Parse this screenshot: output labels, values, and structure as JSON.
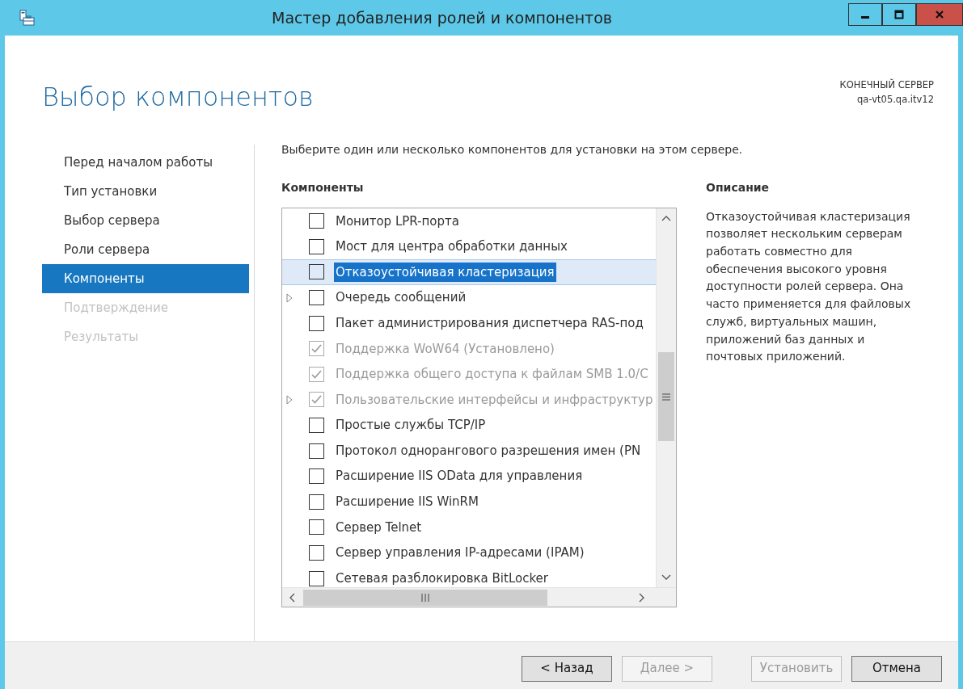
{
  "window": {
    "title": "Мастер добавления ролей и компонентов"
  },
  "page_title": "Выбор компонентов",
  "destination": {
    "label": "КОНЕЧНЫЙ СЕРВЕР",
    "server": "qa-vt05.qa.itv12"
  },
  "steps": [
    {
      "label": "Перед началом работы",
      "selected": false,
      "disabled": false
    },
    {
      "label": "Тип установки",
      "selected": false,
      "disabled": false
    },
    {
      "label": "Выбор сервера",
      "selected": false,
      "disabled": false
    },
    {
      "label": "Роли сервера",
      "selected": false,
      "disabled": false
    },
    {
      "label": "Компоненты",
      "selected": true,
      "disabled": false
    },
    {
      "label": "Подтверждение",
      "selected": false,
      "disabled": true
    },
    {
      "label": "Результаты",
      "selected": false,
      "disabled": true
    }
  ],
  "instruction": "Выберите один или несколько компонентов для установки на этом сервере.",
  "features": {
    "heading": "Компоненты",
    "items": [
      {
        "label": "Монитор LPR-порта",
        "expandable": false,
        "checked": false,
        "disabled": false,
        "selected": false
      },
      {
        "label": "Мост для центра обработки данных",
        "expandable": false,
        "checked": false,
        "disabled": false,
        "selected": false
      },
      {
        "label": "Отказоустойчивая кластеризация",
        "expandable": false,
        "checked": false,
        "disabled": false,
        "selected": true
      },
      {
        "label": "Очередь сообщений",
        "expandable": true,
        "checked": false,
        "disabled": false,
        "selected": false
      },
      {
        "label": "Пакет администрирования диспетчера RAS-под",
        "expandable": false,
        "checked": false,
        "disabled": false,
        "selected": false
      },
      {
        "label": "Поддержка WoW64 (Установлено)",
        "expandable": false,
        "checked": true,
        "disabled": true,
        "selected": false
      },
      {
        "label": "Поддержка общего доступа к файлам SMB 1.0/С",
        "expandable": false,
        "checked": true,
        "disabled": true,
        "selected": false
      },
      {
        "label": "Пользовательские интерфейсы и инфраструктур",
        "expandable": true,
        "checked": true,
        "disabled": true,
        "selected": false
      },
      {
        "label": "Простые службы TCP/IP",
        "expandable": false,
        "checked": false,
        "disabled": false,
        "selected": false
      },
      {
        "label": "Протокол однорангового разрешения имен (PN",
        "expandable": false,
        "checked": false,
        "disabled": false,
        "selected": false
      },
      {
        "label": "Расширение IIS OData для управления",
        "expandable": false,
        "checked": false,
        "disabled": false,
        "selected": false
      },
      {
        "label": "Расширение IIS WinRM",
        "expandable": false,
        "checked": false,
        "disabled": false,
        "selected": false
      },
      {
        "label": "Сервер Telnet",
        "expandable": false,
        "checked": false,
        "disabled": false,
        "selected": false
      },
      {
        "label": "Сервер управления IP-адресами (IPAM)",
        "expandable": false,
        "checked": false,
        "disabled": false,
        "selected": false
      },
      {
        "label": "Сетевая разблокировка BitLocker",
        "expandable": false,
        "checked": false,
        "disabled": false,
        "selected": false
      }
    ]
  },
  "description": {
    "heading": "Описание",
    "text": "Отказоустойчивая кластеризация позволяет нескольким серверам работать совместно для обеспечения высокого уровня доступности ролей сервера. Она часто применяется для файловых служб, виртуальных машин, приложений баз данных и почтовых приложений."
  },
  "buttons": [
    {
      "label": "< Назад",
      "disabled": false
    },
    {
      "label": "Далее >",
      "disabled": true
    },
    {
      "label": "Установить",
      "disabled": true
    },
    {
      "label": "Отмена",
      "disabled": false
    }
  ]
}
